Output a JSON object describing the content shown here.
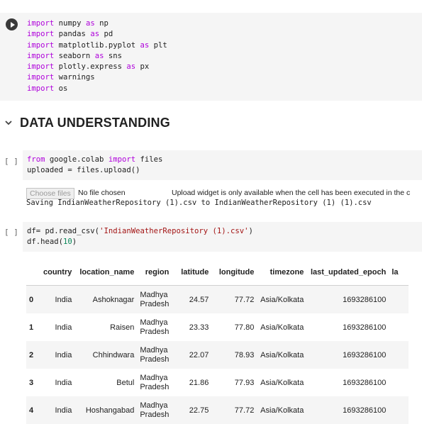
{
  "cell1": {
    "lines": [
      {
        "kw": "import",
        "rest": " numpy ",
        "kw2": "as",
        "rest2": " np"
      },
      {
        "kw": "import",
        "rest": " pandas ",
        "kw2": "as",
        "rest2": " pd"
      },
      {
        "kw": "import",
        "rest": " matplotlib.pyplot ",
        "kw2": "as",
        "rest2": " plt"
      },
      {
        "kw": "import",
        "rest": " seaborn ",
        "kw2": "as",
        "rest2": " sns"
      },
      {
        "kw": "import",
        "rest": " plotly.express ",
        "kw2": "as",
        "rest2": " px"
      },
      {
        "kw": "import",
        "rest": " warnings",
        "kw2": "",
        "rest2": ""
      },
      {
        "kw": "import",
        "rest": " os",
        "kw2": "",
        "rest2": ""
      }
    ]
  },
  "section": {
    "title": "DATA UNDERSTANDING"
  },
  "cell2": {
    "bracket": "[ ]",
    "line1_kw1": "from",
    "line1_mid": " google.colab ",
    "line1_kw2": "import",
    "line1_end": " files",
    "line2": "uploaded = files.upload()",
    "choose_label": "Choose files",
    "no_file": "No file chosen",
    "widget_note": "Upload widget is only available when the cell has been executed in the c",
    "saving": "Saving IndianWeatherRepository (1).csv to IndianWeatherRepository (1) (1).csv"
  },
  "cell3": {
    "bracket": "[ ]",
    "line1_pre": "df= pd.read_csv(",
    "line1_str": "'IndianWeatherRepository (1).csv'",
    "line1_post": ")",
    "line2_pre": "df.head(",
    "line2_num": "10",
    "line2_post": ")"
  },
  "table": {
    "columns": [
      "",
      "country",
      "location_name",
      "region",
      "latitude",
      "longitude",
      "timezone",
      "last_updated_epoch",
      "la"
    ],
    "rows": [
      {
        "idx": "0",
        "country": "India",
        "location_name": "Ashoknagar",
        "region_a": "Madhya",
        "region_b": "Pradesh",
        "latitude": "24.57",
        "longitude": "77.72",
        "timezone": "Asia/Kolkata",
        "epoch": "1693286100"
      },
      {
        "idx": "1",
        "country": "India",
        "location_name": "Raisen",
        "region_a": "Madhya",
        "region_b": "Pradesh",
        "latitude": "23.33",
        "longitude": "77.80",
        "timezone": "Asia/Kolkata",
        "epoch": "1693286100"
      },
      {
        "idx": "2",
        "country": "India",
        "location_name": "Chhindwara",
        "region_a": "Madhya",
        "region_b": "Pradesh",
        "latitude": "22.07",
        "longitude": "78.93",
        "timezone": "Asia/Kolkata",
        "epoch": "1693286100"
      },
      {
        "idx": "3",
        "country": "India",
        "location_name": "Betul",
        "region_a": "Madhya",
        "region_b": "Pradesh",
        "latitude": "21.86",
        "longitude": "77.93",
        "timezone": "Asia/Kolkata",
        "epoch": "1693286100"
      },
      {
        "idx": "4",
        "country": "India",
        "location_name": "Hoshangabad",
        "region_a": "Madhya",
        "region_b": "Pradesh",
        "latitude": "22.75",
        "longitude": "77.72",
        "timezone": "Asia/Kolkata",
        "epoch": "1693286100"
      }
    ]
  }
}
